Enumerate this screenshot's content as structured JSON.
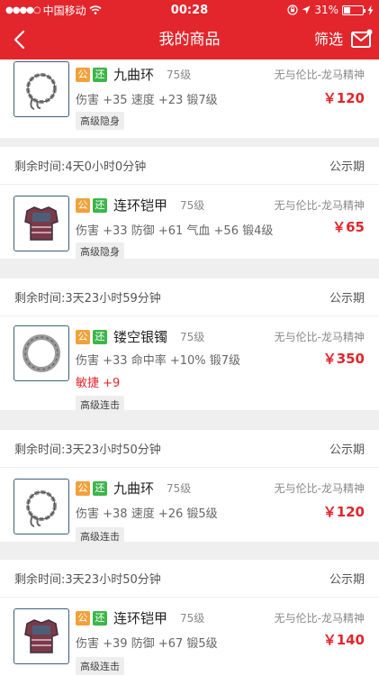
{
  "status_bar": {
    "carrier": "中国移动",
    "time": "00:28",
    "battery": "31%",
    "battery_level": 0.31
  },
  "nav": {
    "title": "我的商品",
    "filter_label": "筛选"
  },
  "tags": {
    "gong": "公",
    "huan": "还"
  },
  "status_label": "公示期",
  "items": [
    {
      "name": "九曲环",
      "level": "75级",
      "server": "无与伦比-龙马精神",
      "stats": "伤害 +35 速度 +23 锻7级",
      "price": "￥120",
      "skill": "高级隐身",
      "icon": "ring-chain-icon"
    },
    {
      "remaining": "剩余时间:4天0小时0分钟",
      "name": "连环铠甲",
      "level": "75级",
      "server": "无与伦比-龙马精神",
      "stats": "伤害 +33 防御 +61 气血 +56 锻4级",
      "price": "￥65",
      "skill": "高级隐身",
      "icon": "armor-icon"
    },
    {
      "remaining": "剩余时间:3天23小时59分钟",
      "name": "镂空银镯",
      "level": "75级",
      "server": "无与伦比-龙马精神",
      "stats": "伤害 +33 命中率 +10% 锻7级",
      "extra": "敏捷 +9",
      "price": "￥350",
      "skill": "高级连击",
      "icon": "silver-bracelet-icon"
    },
    {
      "remaining": "剩余时间:3天23小时50分钟",
      "name": "九曲环",
      "level": "75级",
      "server": "无与伦比-龙马精神",
      "stats": "伤害 +38 速度 +26 锻5级",
      "price": "￥120",
      "skill": "高级连击",
      "icon": "ring-chain-icon"
    },
    {
      "remaining": "剩余时间:3天23小时50分钟",
      "name": "连环铠甲",
      "level": "75级",
      "server": "无与伦比-龙马精神",
      "stats": "伤害 +39 防御 +67 锻5级",
      "price": "￥140",
      "skill": "高级连击",
      "icon": "armor-icon"
    }
  ],
  "colors": {
    "brand": "#e2262c",
    "tag_gong": "#f2a13a",
    "tag_huan": "#3cb64a",
    "price": "#e2262c"
  }
}
